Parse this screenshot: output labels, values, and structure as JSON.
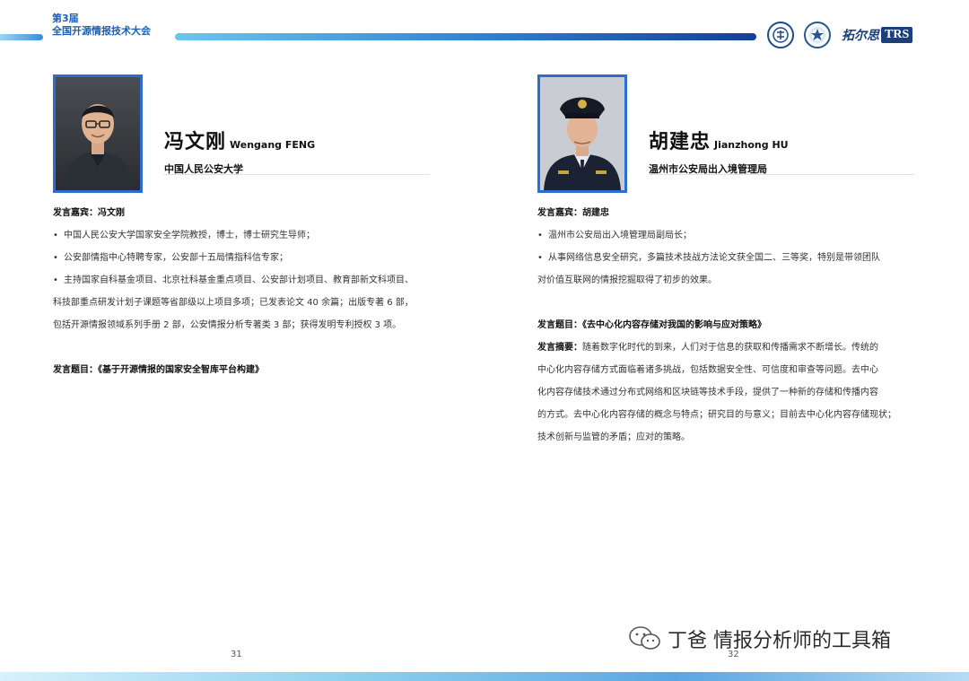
{
  "header": {
    "line1": "第3届",
    "line2": "全国开源情报技术大会",
    "logo_trs_cn": "拓尔思",
    "logo_trs_en": "TRS"
  },
  "left": {
    "speaker_name_cn": "冯文刚",
    "speaker_name_en": "Wengang FENG",
    "org": "中国人民公安大学",
    "guest_label": "发言嘉宾：",
    "guest_name": "冯文刚",
    "bullets": [
      "中国人民公安大学国家安全学院教授，博士，博士研究生导师；",
      "公安部情指中心特聘专家，公安部十五局情指科信专家；",
      "主持国家自科基金项目、北京社科基金重点项目、公安部计划项目、教育部新文科项目、"
    ],
    "bullet_continuation": [
      "科技部重点研发计划子课题等省部级以上项目多项；已发表论文 40 余篇；出版专著 6 部，",
      "包括开源情报领域系列手册 2 部，公安情报分析专著类 3 部；获得发明专利授权 3 项。"
    ],
    "topic_label": "发言题目：",
    "topic": "《基于开源情报的国家安全智库平台构建》",
    "page_number": "31"
  },
  "right": {
    "speaker_name_cn": "胡建忠",
    "speaker_name_en": "Jianzhong HU",
    "org": "温州市公安局出入境管理局",
    "guest_label": "发言嘉宾：",
    "guest_name": "胡建忠",
    "bullets": [
      "温州市公安局出入境管理局副局长；",
      "从事网络信息安全研究，多篇技术技战方法论文获全国二、三等奖，特别是带领团队"
    ],
    "bullet_continuation": [
      "对价值互联网的情报挖掘取得了初步的效果。"
    ],
    "topic_label": "发言题目：",
    "topic": "《去中心化内容存储对我国的影响与应对策略》",
    "abstract_label": "发言摘要：",
    "abstract_lines": [
      "随着数字化时代的到来，人们对于信息的获取和传播需求不断增长。传统的",
      "中心化内容存储方式面临着诸多挑战，包括数据安全性、可信度和审查等问题。去中心",
      "化内容存储技术通过分布式网络和区块链等技术手段，提供了一种新的存储和传播内容",
      "的方式。去中心化内容存储的概念与特点；研究目的与意义；目前去中心化内容存储现状；",
      "技术创新与监管的矛盾；应对的策略。"
    ],
    "page_number": "32"
  },
  "watermark": {
    "text": "丁爸 情报分析师的工具箱",
    "icon": "wechat-icon"
  }
}
